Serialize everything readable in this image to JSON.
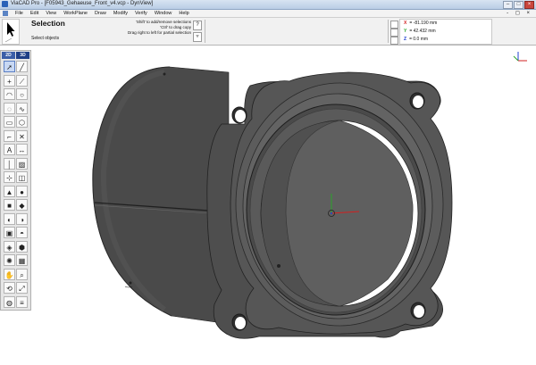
{
  "window": {
    "title": "ViaCAD Pro - [F05943_Gehaeuse_Front_v4.vcp - DynView]",
    "controls": [
      "–",
      "□",
      "×"
    ]
  },
  "menu": {
    "items": [
      "File",
      "Edit",
      "View",
      "WorkPlane",
      "Draw",
      "Modify",
      "Verify",
      "Window",
      "Help"
    ],
    "mdi_controls": "- ◻ ×"
  },
  "prompt": {
    "tool_name": "Selection",
    "status": "Select objects",
    "hints": [
      "'Shift' to add/remove selections",
      "'Ctrl' to drag copy",
      "Drag right to left for partial selection"
    ],
    "help_button": "?",
    "options_button": "▿"
  },
  "coordinates": {
    "x_label": "X",
    "x_value": "= -81.190 mm",
    "y_label": "Y",
    "y_value": "= 42.432 mm",
    "z_label": "Z",
    "z_value": "= 0.0 mm"
  },
  "palette": {
    "tabs": [
      "2D",
      "3D"
    ],
    "tools": [
      {
        "icon": "select-arrow-icon",
        "glyph": "➚"
      },
      {
        "icon": "line-icon",
        "glyph": "╱"
      },
      {
        "icon": "point-icon",
        "glyph": "+"
      },
      {
        "icon": "polyline-icon",
        "glyph": "⟋"
      },
      {
        "icon": "arc-icon",
        "glyph": "◠"
      },
      {
        "icon": "circle-icon",
        "glyph": "○"
      },
      {
        "icon": "ellipse-icon",
        "glyph": "◌"
      },
      {
        "icon": "spline-icon",
        "glyph": "∿"
      },
      {
        "icon": "rectangle-icon",
        "glyph": "▭"
      },
      {
        "icon": "polygon-icon",
        "glyph": "⬡"
      },
      {
        "icon": "trim-icon",
        "glyph": "⌐"
      },
      {
        "icon": "delete-icon",
        "glyph": "✕"
      },
      {
        "icon": "text-icon",
        "glyph": "A"
      },
      {
        "icon": "dimension-icon",
        "glyph": "↔"
      },
      {
        "icon": "construction-icon",
        "glyph": "│"
      },
      {
        "icon": "hatch-icon",
        "glyph": "▨"
      },
      {
        "icon": "transform-icon",
        "glyph": "⊹"
      },
      {
        "icon": "mirror-icon",
        "glyph": "◫"
      },
      {
        "icon": "extrude-icon",
        "glyph": "▲"
      },
      {
        "icon": "sphere-icon",
        "glyph": "●"
      },
      {
        "icon": "box-icon",
        "glyph": "■"
      },
      {
        "icon": "cone-icon",
        "glyph": "◆"
      },
      {
        "icon": "revolve-icon",
        "glyph": "◐"
      },
      {
        "icon": "sweep-icon",
        "glyph": "◑"
      },
      {
        "icon": "shell-icon",
        "glyph": "▣"
      },
      {
        "icon": "fillet-icon",
        "glyph": "◓"
      },
      {
        "icon": "surface-icon",
        "glyph": "◈"
      },
      {
        "icon": "boolean-icon",
        "glyph": "⬢"
      },
      {
        "icon": "light-icon",
        "glyph": "✺"
      },
      {
        "icon": "camera-icon",
        "glyph": "▦"
      },
      {
        "icon": "pan-hand-icon",
        "glyph": "✋"
      },
      {
        "icon": "zoom-icon",
        "glyph": "⌕"
      },
      {
        "icon": "rotate-view-icon",
        "glyph": "⟲"
      },
      {
        "icon": "fit-view-icon",
        "glyph": "⤢"
      },
      {
        "icon": "render-icon",
        "glyph": "◍"
      },
      {
        "icon": "layers-icon",
        "glyph": "≡"
      }
    ]
  },
  "colors": {
    "model_body": "#4a4a4a",
    "model_dark": "#2e2e2e",
    "model_light": "#6a6a6a",
    "axis_x": "#d22020",
    "axis_y": "#2aa52a",
    "axis_z": "#2040d0"
  }
}
